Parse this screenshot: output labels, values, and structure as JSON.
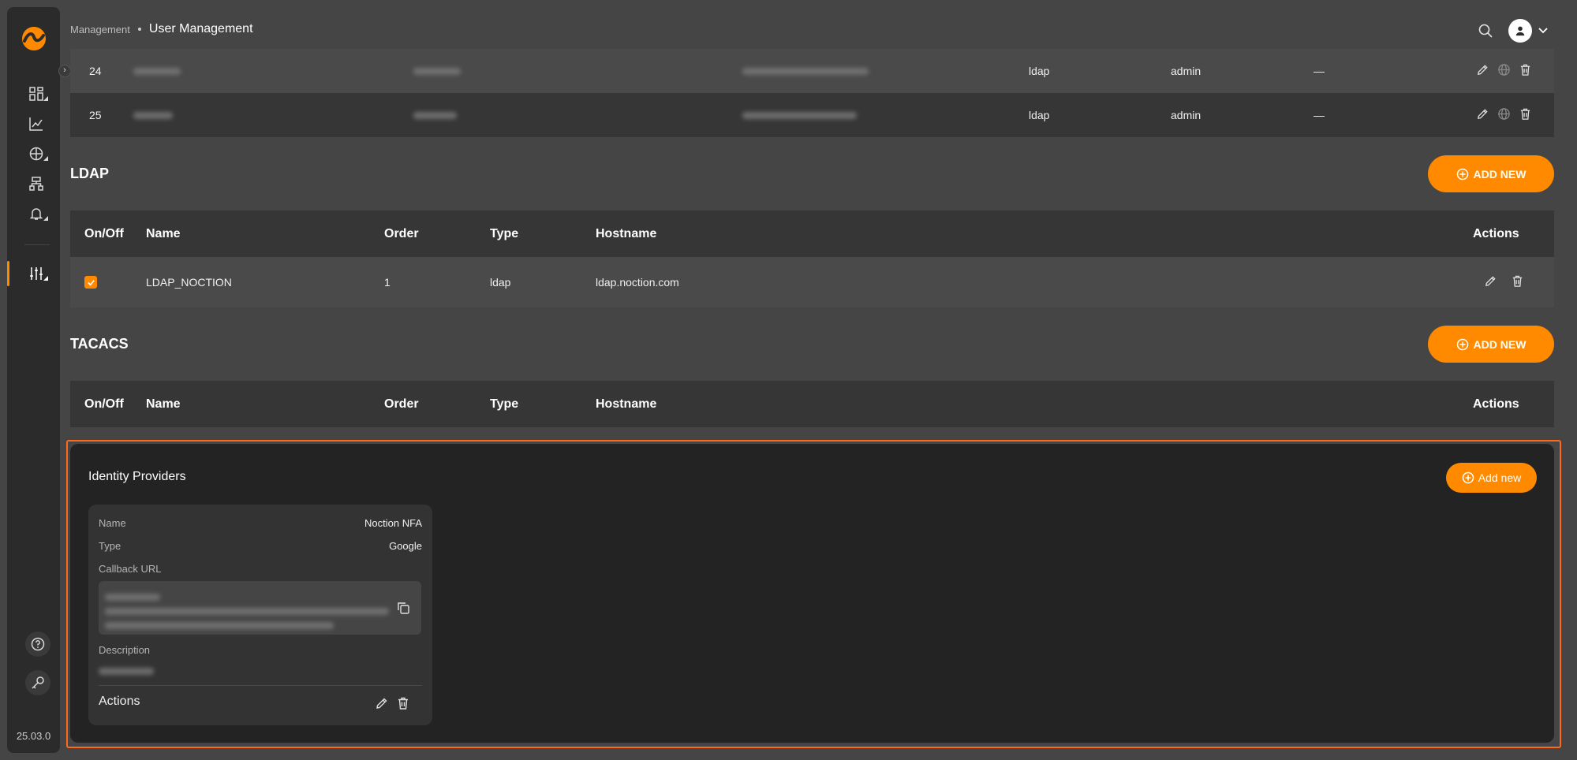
{
  "app": {
    "version": "25.03.0",
    "accent": "#ff8a00"
  },
  "breadcrumb": {
    "parent": "Management",
    "current": "User Management"
  },
  "users": {
    "rows": [
      {
        "id": "24",
        "type": "ldap",
        "role": "admin",
        "extra": "—"
      },
      {
        "id": "25",
        "type": "ldap",
        "role": "admin",
        "extra": "—"
      }
    ]
  },
  "ldap": {
    "title": "LDAP",
    "add_label": "ADD NEW",
    "columns": [
      "On/Off",
      "Name",
      "Order",
      "Type",
      "Hostname",
      "Actions"
    ],
    "rows": [
      {
        "enabled": true,
        "name": "LDAP_NOCTION",
        "order": "1",
        "type": "ldap",
        "hostname": "ldap.noction.com"
      }
    ]
  },
  "tacacs": {
    "title": "TACACS",
    "add_label": "ADD NEW",
    "columns": [
      "On/Off",
      "Name",
      "Order",
      "Type",
      "Hostname",
      "Actions"
    ]
  },
  "idp": {
    "title": "Identity Providers",
    "add_label": "Add new",
    "card": {
      "name_label": "Name",
      "name_value": "Noction NFA",
      "type_label": "Type",
      "type_value": "Google",
      "callback_label": "Callback URL",
      "description_label": "Description",
      "actions_label": "Actions"
    }
  }
}
